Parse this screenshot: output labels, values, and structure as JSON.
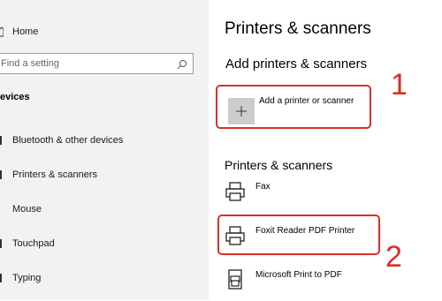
{
  "sidebar": {
    "home_label": "Home",
    "search_placeholder": "Find a setting",
    "section_label": "evices",
    "items": [
      {
        "label": "Bluetooth & other devices"
      },
      {
        "label": "Printers & scanners"
      },
      {
        "label": "Mouse"
      },
      {
        "label": "Touchpad"
      },
      {
        "label": "Typing"
      }
    ]
  },
  "main": {
    "page_title": "Printers & scanners",
    "add_section_title": "Add printers & scanners",
    "add_button_label": "Add a printer or scanner",
    "list_title": "Printers & scanners",
    "printers": [
      {
        "name": "Fax",
        "icon": "printer-icon"
      },
      {
        "name": "Foxit Reader PDF Printer",
        "icon": "printer-icon"
      },
      {
        "name": "Microsoft Print to PDF",
        "icon": "pdf-printer-icon"
      }
    ]
  },
  "annotations": {
    "step1": "1",
    "step2": "2",
    "highlight_color": "#d93025"
  },
  "colors": {
    "sidebar_bg": "#f2f2f2",
    "tile_gray": "#cccccc"
  }
}
